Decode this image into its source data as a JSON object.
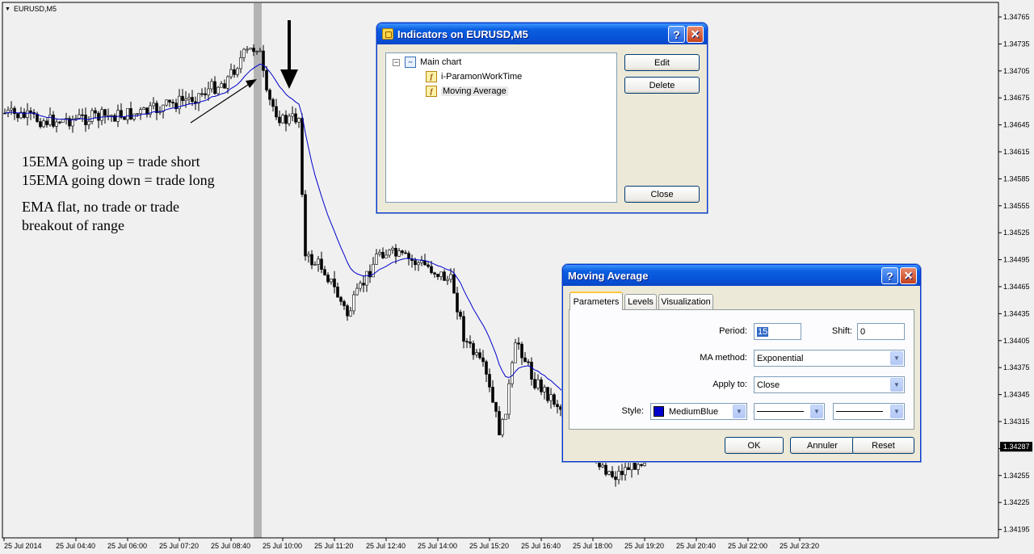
{
  "chart": {
    "symbol": "EURUSD,M5",
    "price_labels": [
      "1.34765",
      "1.34735",
      "1.34705",
      "1.34675",
      "1.34645",
      "1.34615",
      "1.34585",
      "1.34555",
      "1.34525",
      "1.34495",
      "1.34465",
      "1.34435",
      "1.34405",
      "1.34375",
      "1.34345",
      "1.34315",
      "1.34285",
      "1.34255",
      "1.34225",
      "1.34195"
    ],
    "current_price": "1.34287",
    "time_labels": [
      "25 Jul 2014",
      "25 Jul 04:40",
      "25 Jul 06:00",
      "25 Jul 07:20",
      "25 Jul 08:40",
      "25 Jul 10:00",
      "25 Jul 11:20",
      "25 Jul 12:40",
      "25 Jul 14:00",
      "25 Jul 15:20",
      "25 Jul 16:40",
      "25 Jul 18:00",
      "25 Jul 19:20",
      "25 Jul 20:40",
      "25 Jul 22:00",
      "25 Jul 23:20"
    ],
    "colors": {
      "background": "#f0f0f0",
      "ema_line": "#0000cd",
      "candle_border": "#000000",
      "bull_body": "#ffffff",
      "bear_body": "#000000",
      "separator": "#b4b4b4"
    }
  },
  "annotations": {
    "line1": "15EMA going up = trade short",
    "line2": "15EMA going down = trade long",
    "line3": "EMA flat, no trade or trade",
    "line4": "breakout of range"
  },
  "indicators_dialog": {
    "title": "Indicators on EURUSD,M5",
    "help_glyph": "?",
    "close_glyph": "✕",
    "tree": {
      "root": "Main chart",
      "items": [
        "i-ParamonWorkTime",
        "Moving Average"
      ]
    },
    "buttons": {
      "edit": "Edit",
      "delete": "Delete",
      "close": "Close"
    }
  },
  "ma_dialog": {
    "title": "Moving Average",
    "help_glyph": "?",
    "close_glyph": "✕",
    "tabs": [
      "Parameters",
      "Levels",
      "Visualization"
    ],
    "period_label": "Period:",
    "period_value": "15",
    "shift_label": "Shift:",
    "shift_value": "0",
    "method_label": "MA method:",
    "method_value": "Exponential",
    "apply_label": "Apply to:",
    "apply_value": "Close",
    "style_label": "Style:",
    "style_color_name": "MediumBlue",
    "style_color": "#0000cd",
    "buttons": {
      "ok": "OK",
      "cancel": "Annuler",
      "reset": "Reset"
    }
  }
}
